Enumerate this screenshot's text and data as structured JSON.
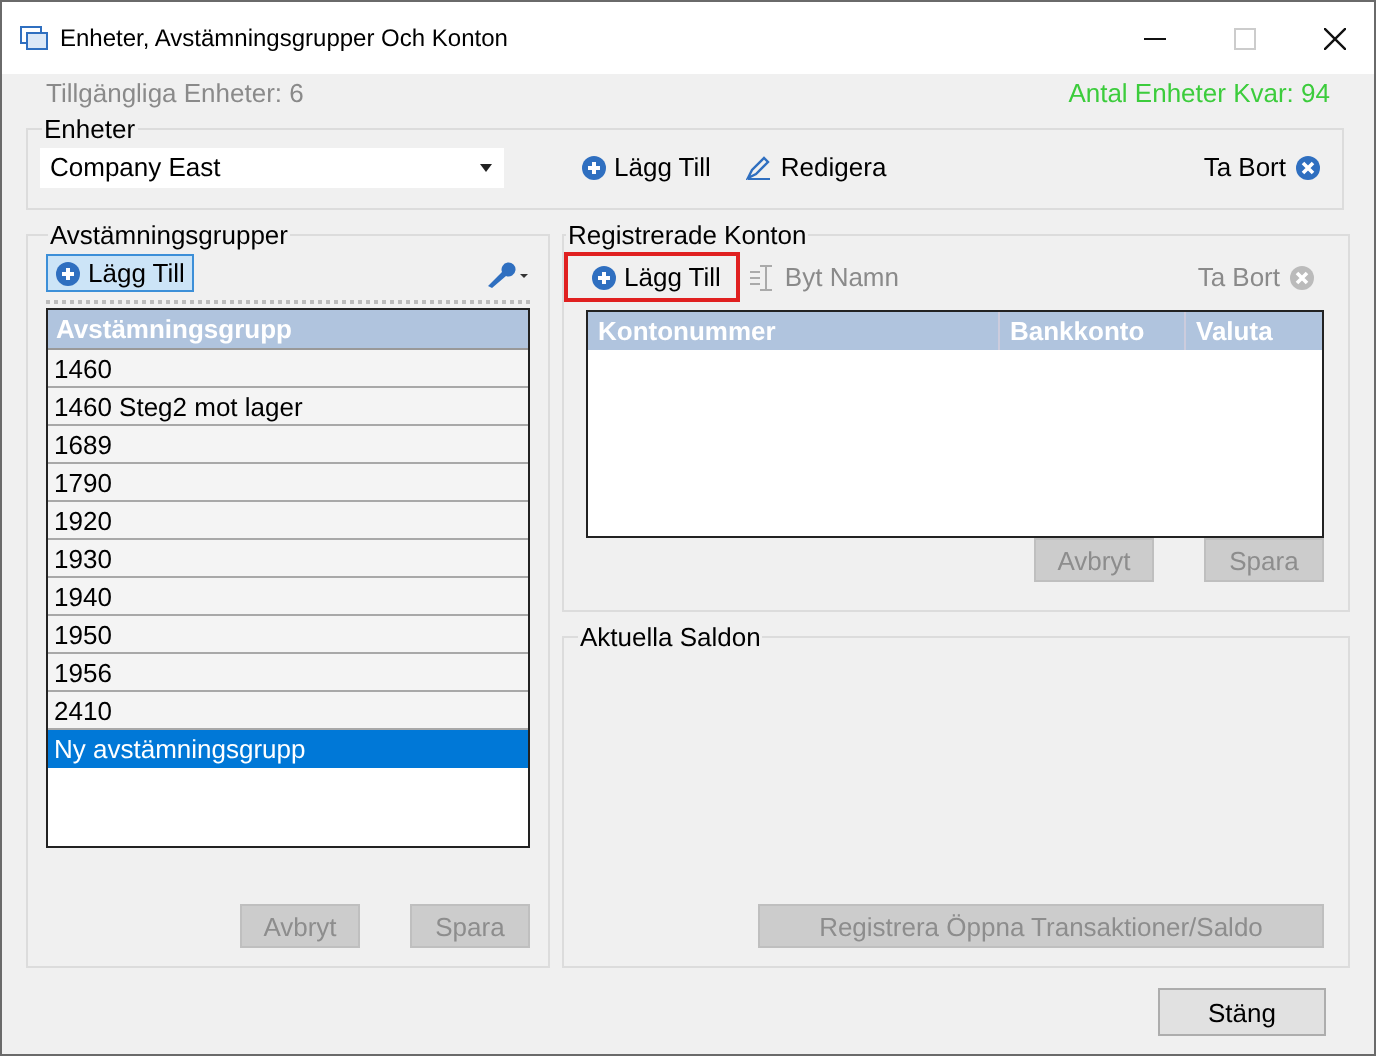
{
  "window": {
    "title": "Enheter, Avstämningsgrupper Och Konton",
    "maximize_disabled": true
  },
  "header": {
    "available_units": "Tillgängliga Enheter: 6",
    "units_left": "Antal Enheter Kvar: 94"
  },
  "units": {
    "title": "Enheter",
    "selected_unit": "Company East",
    "add": {
      "label": "Lägg Till",
      "disabled": false
    },
    "edit": {
      "label": "Redigera",
      "disabled": false
    },
    "remove": {
      "label": "Ta Bort",
      "disabled": false
    }
  },
  "groups": {
    "title": "Avstämningsgrupper",
    "add": {
      "label": "Lägg Till",
      "disabled": false
    },
    "column": "Avstämningsgrupp",
    "rows": [
      {
        "name": "1460",
        "selected": false
      },
      {
        "name": "1460 Steg2 mot lager",
        "selected": false
      },
      {
        "name": "1689",
        "selected": false
      },
      {
        "name": "1790",
        "selected": false
      },
      {
        "name": "1920",
        "selected": false
      },
      {
        "name": "1930",
        "selected": false
      },
      {
        "name": "1940",
        "selected": false
      },
      {
        "name": "1950",
        "selected": false
      },
      {
        "name": "1956",
        "selected": false
      },
      {
        "name": "2410",
        "selected": false
      },
      {
        "name": "Ny avstämningsgrupp",
        "selected": true
      }
    ],
    "cancel": {
      "label": "Avbryt",
      "disabled": true
    },
    "save": {
      "label": "Spara",
      "disabled": true
    }
  },
  "accounts": {
    "title": "Registrerade Konton",
    "add": {
      "label": "Lägg Till",
      "disabled": false,
      "highlighted": true
    },
    "rename": {
      "label": "Byt Namn",
      "disabled": true
    },
    "remove": {
      "label": "Ta Bort",
      "disabled": true
    },
    "columns": [
      "Kontonummer",
      "Bankkonto",
      "Valuta"
    ],
    "cancel": {
      "label": "Avbryt",
      "disabled": true
    },
    "save": {
      "label": "Spara",
      "disabled": true
    }
  },
  "balances": {
    "title": "Aktuella Saldon",
    "register": {
      "label": "Registrera Öppna Transaktioner/Saldo",
      "disabled": true
    }
  },
  "close": {
    "label": "Stäng",
    "disabled": false
  }
}
